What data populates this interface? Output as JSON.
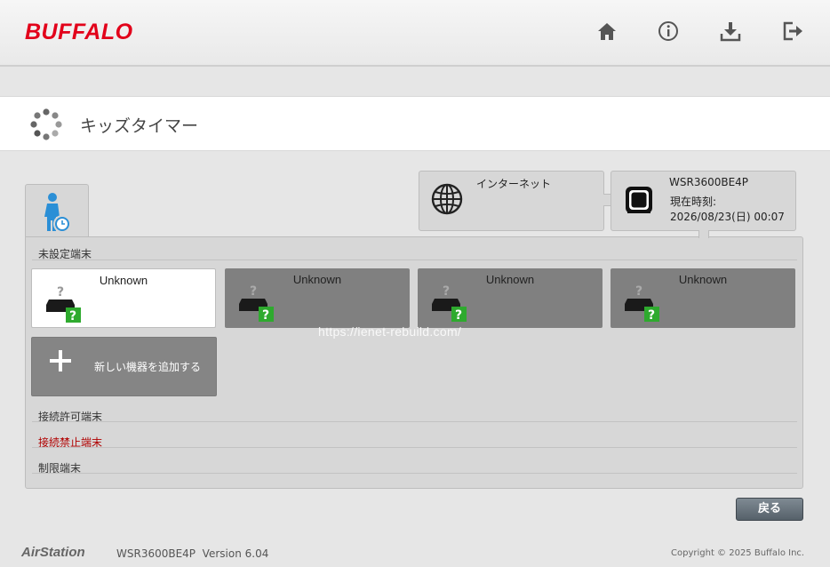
{
  "header": {
    "logo": "BUFFALO",
    "icons": [
      "home-icon",
      "info-icon",
      "download-icon",
      "logout-icon"
    ]
  },
  "page": {
    "title": "キッズタイマー"
  },
  "status": {
    "internet_label": "インターネット",
    "router_model": "WSR3600BE4P",
    "time_label": "現在時刻:",
    "time_value": "2026/08/23(日) 00:07"
  },
  "sections": {
    "unset": "未設定端末",
    "allowed": "接続許可端末",
    "blocked": "接続禁止端末",
    "limited": "制限端末"
  },
  "devices": [
    {
      "label": "Unknown",
      "selected": true
    },
    {
      "label": "Unknown",
      "selected": false
    },
    {
      "label": "Unknown",
      "selected": false
    },
    {
      "label": "Unknown",
      "selected": false
    }
  ],
  "add_device": {
    "label": "新しい機器を追加する"
  },
  "watermark": "https://ienet-rebuild.com/",
  "back_button": "戻る",
  "footer": {
    "brand": "AirStation",
    "model": "WSR3600BE4P  Version 6.04",
    "copyright": "Copyright © 2025 Buffalo Inc."
  },
  "colors": {
    "logo": "#e2001a",
    "blocked_text": "#b00000",
    "unknown_badge": "#2eaa2e",
    "kids_icon": "#2b8fd6"
  }
}
